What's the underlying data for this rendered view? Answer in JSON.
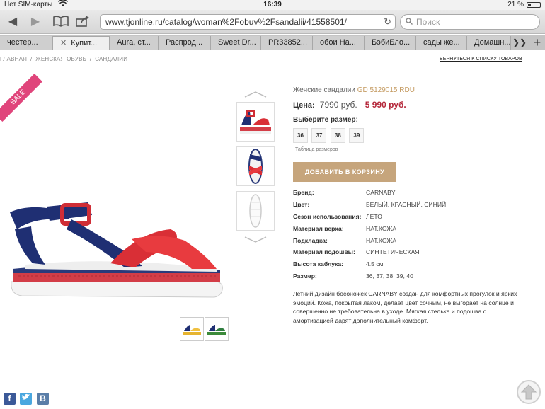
{
  "status": {
    "carrier": "Нет SIM-карты",
    "time": "16:39",
    "battery": "21 %"
  },
  "browser": {
    "url": "www.tjonline.ru/catalog/woman%2Fobuv%2Fsandalii/41558501/",
    "search_placeholder": "Поиск",
    "tabs": [
      {
        "label": "честер..."
      },
      {
        "label": "Купит..."
      },
      {
        "label": "Aura, ст..."
      },
      {
        "label": "Распрод..."
      },
      {
        "label": "Sweet Dr..."
      },
      {
        "label": "PR33852..."
      },
      {
        "label": "обои На..."
      },
      {
        "label": "БэбиБло..."
      },
      {
        "label": "сады же..."
      },
      {
        "label": "Домашн..."
      }
    ]
  },
  "breadcrumb": {
    "items": [
      "ГЛАВНАЯ",
      "ЖЕНСКАЯ ОБУВЬ",
      "САНДАЛИИ"
    ],
    "return_link": "ВЕРНУТЬСЯ К СПИСКУ ТОВАРОВ"
  },
  "badge": {
    "sale": "SALE"
  },
  "product": {
    "title": "Женские сандалии",
    "code": "GD 5129015 RDU",
    "price_label": "Цена:",
    "old_price": "7990 руб.",
    "new_price": "5 990 руб.",
    "size_label": "Выберите размер:",
    "sizes": [
      "36",
      "37",
      "38",
      "39"
    ],
    "size_table": "Таблица размеров",
    "add_to_cart": "ДОБАВИТЬ В КОРЗИНУ",
    "specs": [
      {
        "k": "Бренд:",
        "v": "CARNABY"
      },
      {
        "k": "Цвет:",
        "v": "БЕЛЫЙ, КРАСНЫЙ, СИНИЙ"
      },
      {
        "k": "Сезон использования:",
        "v": "ЛЕТО"
      },
      {
        "k": "Материал верха:",
        "v": "НАТ.КОЖА"
      },
      {
        "k": "Подкладка:",
        "v": "НАТ.КОЖА"
      },
      {
        "k": "Материал подошвы:",
        "v": "СИНТЕТИЧЕСКАЯ"
      },
      {
        "k": "Высота каблука:",
        "v": "4.5 см"
      },
      {
        "k": "Размер:",
        "v": "36, 37, 38, 39, 40"
      }
    ],
    "description": "Летний дизайн босоножек CARNABY создан для комфортных прогулок и ярких эмоций. Кожа, покрытая лаком, делает цвет сочным, не выгорает на солнце и совершенно не требовательна в уходе. Мягкая стелька и подошва с амортизацией дарят дополнительный комфорт."
  },
  "colors": {
    "accent": "#c6a57c",
    "price_new": "#b5283b",
    "sale": "#e0457b"
  }
}
